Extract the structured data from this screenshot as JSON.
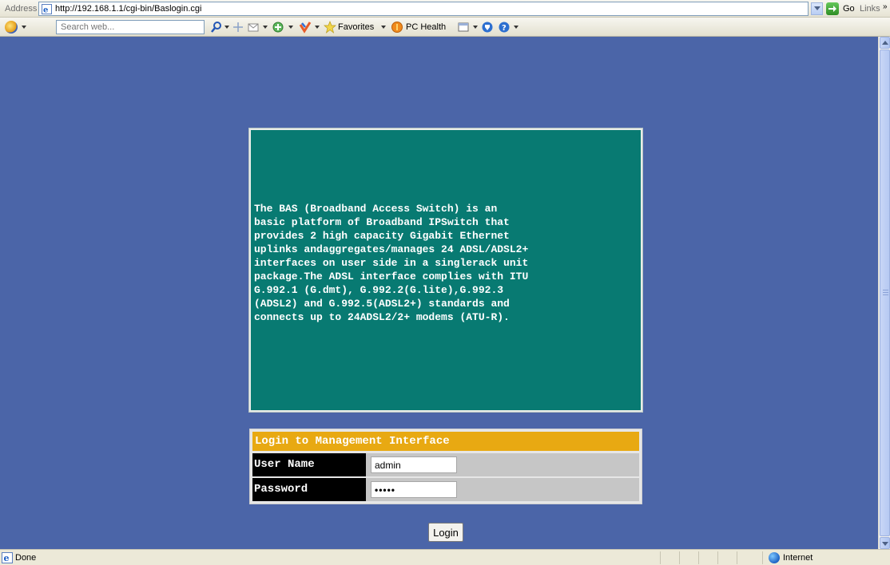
{
  "address_bar": {
    "label": "Address",
    "url": "http://192.168.1.1/cgi-bin/Baslogin.cgi",
    "go_label": "Go",
    "links_label": "Links",
    "links_more": "»"
  },
  "toolbar": {
    "search_placeholder": "Search web...",
    "favorites_label": "Favorites",
    "pc_health_label": "PC Health"
  },
  "info_panel": {
    "text": "The BAS (Broadband Access Switch) is an\nbasic platform of Broadband IPSwitch that\nprovides 2 high capacity Gigabit Ethernet\nuplinks andaggregates/manages 24 ADSL/ADSL2+\ninterfaces on user side in a singlerack unit\npackage.The ADSL interface complies with ITU\nG.992.1 (G.dmt), G.992.2(G.lite),G.992.3\n(ADSL2) and G.992.5(ADSL2+) standards and\nconnects up to 24ADSL2/2+ modems (ATU-R)."
  },
  "login": {
    "header": "Login to Management Interface",
    "username_label": "User Name",
    "username_value": "admin",
    "password_label": "Password",
    "password_value": "•••••",
    "button_label": "Login"
  },
  "status_bar": {
    "status": "Done",
    "zone": "Internet"
  },
  "colors": {
    "page_background": "#4b65a8",
    "panel_background": "#087a72",
    "login_header": "#e8a912",
    "label_cell": "#000000"
  }
}
